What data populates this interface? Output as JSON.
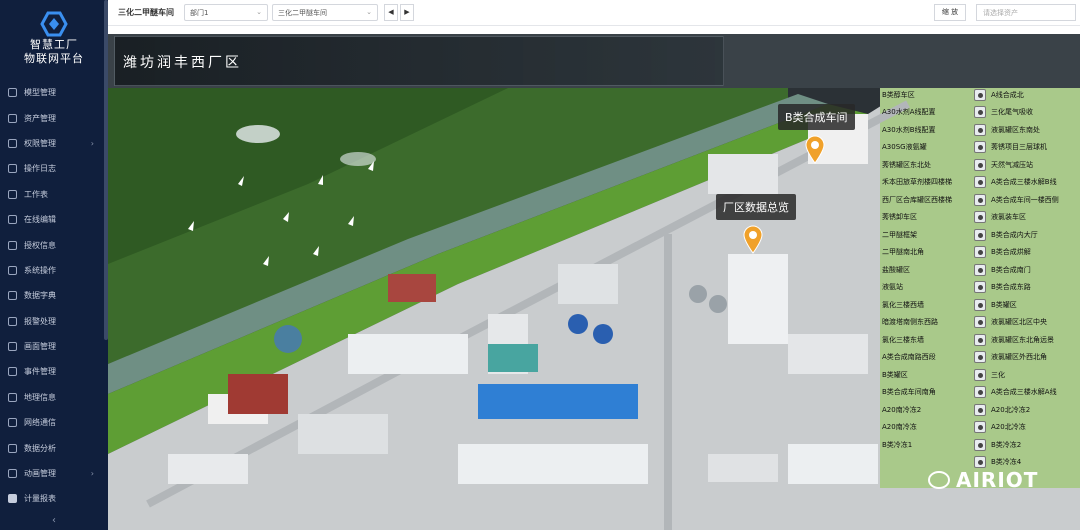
{
  "sidebar": {
    "brand_line1": "智慧工厂",
    "brand_line2": "物联网平台",
    "items": [
      {
        "label": "模型管理",
        "icon": "model-icon"
      },
      {
        "label": "资产管理",
        "icon": "asset-icon"
      },
      {
        "label": "权限管理",
        "icon": "permission-icon",
        "expandable": true
      },
      {
        "label": "操作日志",
        "icon": "log-icon"
      },
      {
        "label": "工作表",
        "icon": "worksheet-icon"
      },
      {
        "label": "在线编辑",
        "icon": "edit-icon"
      },
      {
        "label": "授权信息",
        "icon": "license-icon"
      },
      {
        "label": "系统操作",
        "icon": "system-icon"
      },
      {
        "label": "数据字典",
        "icon": "dictionary-icon"
      },
      {
        "label": "报警处理",
        "icon": "alarm-icon"
      },
      {
        "label": "画面管理",
        "icon": "screen-icon"
      },
      {
        "label": "事件管理",
        "icon": "event-icon"
      },
      {
        "label": "地理信息",
        "icon": "map-icon"
      },
      {
        "label": "网络通信",
        "icon": "network-icon"
      },
      {
        "label": "数据分析",
        "icon": "analysis-icon"
      },
      {
        "label": "动画管理",
        "icon": "animation-icon",
        "expandable": true
      },
      {
        "label": "计量报表",
        "icon": "report-icon"
      }
    ],
    "collapse_label": "‹"
  },
  "toolbar": {
    "title": "三化二甲醚车间",
    "dept_select": "部门1",
    "workshop_select": "三化二甲醚车间",
    "prev_label": "◀",
    "next_label": "▶",
    "zoom_label": "缩 放",
    "search_placeholder": "请选择资产"
  },
  "scene": {
    "area_title": "潍坊润丰西厂区",
    "bubbles": {
      "workshop": "B类合成车间",
      "overview": "厂区数据总览"
    },
    "cameras_col1": [
      "B类醇车区",
      "A30水剂A线配置",
      "A30水剂B线配置",
      "A30SG液氨罐",
      "莠锈罐区东北处",
      "禾本田旅草剂楼四楼梯",
      "西厂区合库罐区西楼梯",
      "莠锈卸车区",
      "二甲醚框架",
      "二甲醚南北角",
      "盐酸罐区",
      "液氨站",
      "氯化三楼西墙",
      "暗渡塔南侧东西路",
      "氯化三楼东墙",
      "A类合成南路西段",
      "B类罐区",
      "B类合成车间南角",
      "A20南冷冻2",
      "A20南冷冻",
      "B类冷冻1"
    ],
    "cameras_col2": [
      "A线合成北",
      "三化尾气吸收",
      "液氯罐区东南处",
      "莠锈项目三层球机",
      "天然气减压站",
      "A类合成三楼水解B线",
      "A类合成车间一楼西侧",
      "液氯装车区",
      "B类合成内大厅",
      "B类合成烘解",
      "B类合成南门",
      "B类合成东路",
      "B类罐区",
      "液氯罐区北区中央",
      "液氯罐区东北角远景",
      "液氯罐区外西北角",
      "三化",
      "A类合成三楼水解A线",
      "A20北冷冻2",
      "A20北冷冻",
      "B类冷冻2",
      "B类冷冻4"
    ],
    "watermark": "AIRIOT"
  }
}
